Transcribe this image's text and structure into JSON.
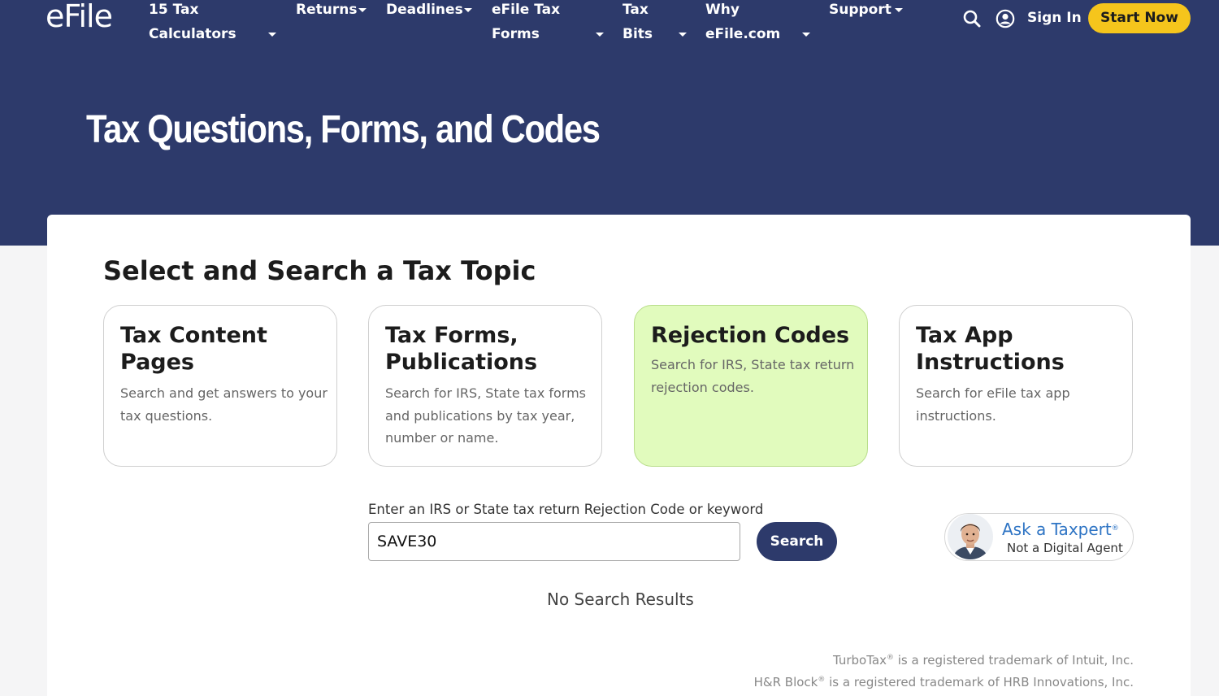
{
  "header": {
    "logo_text": "eFile",
    "nav": {
      "calculators": [
        "15 Tax",
        "Calculators"
      ],
      "returns": "Returns",
      "deadlines": "Deadlines",
      "forms": [
        "eFile Tax",
        "Forms"
      ],
      "bits": [
        "Tax",
        "Bits"
      ],
      "why": [
        "Why",
        "eFile.com"
      ],
      "support": "Support"
    },
    "sign_in": "Sign In",
    "start_now": "Start Now",
    "icons": [
      "search-icon",
      "user-circle-icon",
      "chevron-down-icon"
    ]
  },
  "hero": {
    "title": "Tax Questions, Forms, and Codes"
  },
  "main": {
    "section_title": "Select and Search a Tax Topic",
    "cards": [
      {
        "title": "Tax Content Pages",
        "description": "Search and get answers to your tax questions.",
        "selected": false
      },
      {
        "title": "Tax Forms, Publications",
        "description": "Search for IRS, State tax forms and publications by tax year, number or name.",
        "selected": false
      },
      {
        "title": "Rejection Codes",
        "description": "Search for IRS, State tax return rejection codes.",
        "selected": true
      },
      {
        "title": "Tax App Instructions",
        "description": "Search for eFile tax app instructions.",
        "selected": false
      }
    ],
    "search": {
      "label": "Enter an IRS or State tax return Rejection Code or keyword",
      "value": "SAVE30",
      "button": "Search"
    },
    "taxpert": {
      "title": "Ask a Taxpert",
      "title_mark": "®",
      "subtitle": "Not a Digital Agent"
    },
    "no_results": "No Search Results"
  },
  "footer": {
    "trademarks": [
      {
        "brand": "TurboTax",
        "mark": "®",
        "text": " is a registered trademark of Intuit, Inc."
      },
      {
        "brand": "H&R Block",
        "mark": "®",
        "text": " is a registered trademark of HRB Innovations, Inc."
      }
    ]
  },
  "colors": {
    "header_bg": "#2d3a6b",
    "accent_yellow": "#f5c51c",
    "selected_card_bg": "#e1fbbd",
    "link_blue": "#2e74c4"
  }
}
